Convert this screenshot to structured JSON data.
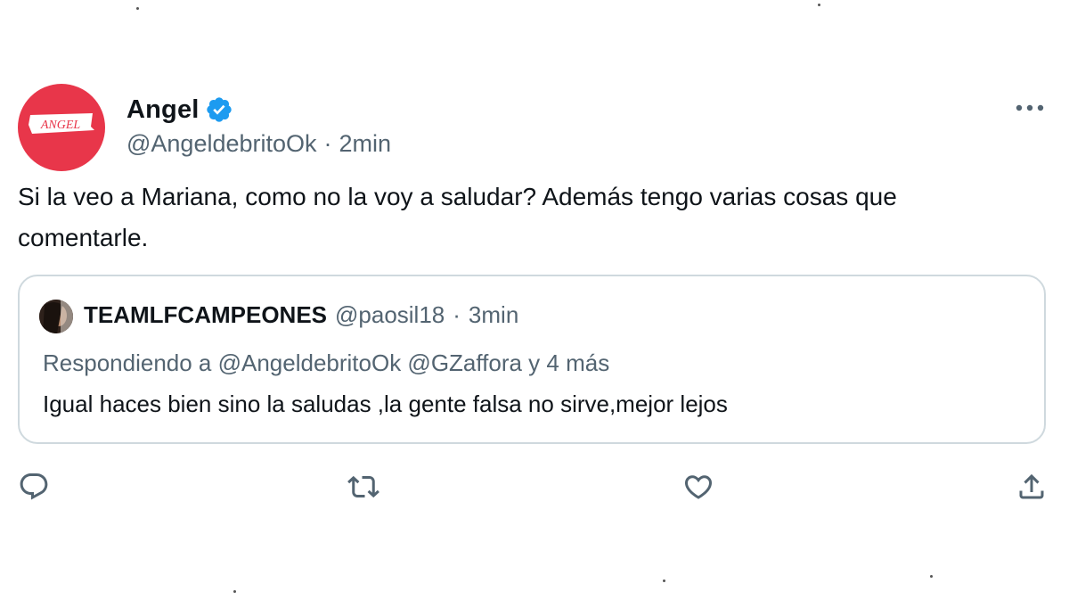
{
  "tweet": {
    "author": {
      "display_name": "Angel",
      "handle": "@AngeldebritoOk",
      "avatar_text": "ANGEL",
      "verified": true
    },
    "separator": "·",
    "time": "2min",
    "text": "Si la veo a Mariana, como no la voy a saludar? Además tengo varias cosas que comentarle."
  },
  "quote": {
    "display_name": "TEAMLFCAMPEONES",
    "handle": "@paosil18",
    "separator": "·",
    "time": "3min",
    "replying_to": "Respondiendo a @AngeldebritoOk @GZaffora y 4 más",
    "text": "Igual haces bien sino la saludas ,la gente falsa no sirve,mejor lejos"
  },
  "actions": {
    "reply_icon": "reply-icon",
    "retweet_icon": "retweet-icon",
    "like_icon": "heart-icon",
    "share_icon": "share-icon"
  },
  "colors": {
    "avatar_bg": "#e8364a",
    "verified_blue": "#1d9bf0",
    "text_primary": "#0f1419",
    "text_secondary": "#536471",
    "border": "#cfd9de"
  }
}
